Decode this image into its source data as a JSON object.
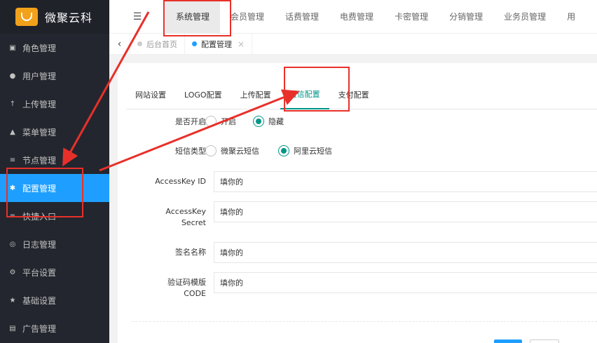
{
  "brand": {
    "name": "微聚云科"
  },
  "sidebar": {
    "items": [
      {
        "label": "角色管理",
        "icon": "role-icon",
        "glyph": "▣"
      },
      {
        "label": "用户管理",
        "icon": "user-icon",
        "glyph": "●"
      },
      {
        "label": "上传管理",
        "icon": "upload-icon",
        "glyph": "↑"
      },
      {
        "label": "菜单管理",
        "icon": "tree-icon",
        "glyph": "▲"
      },
      {
        "label": "节点管理",
        "icon": "list-icon",
        "glyph": "≡"
      },
      {
        "label": "配置管理",
        "icon": "asterisk-icon",
        "glyph": "✱"
      },
      {
        "label": "快捷入口",
        "icon": "list-icon",
        "glyph": "≡"
      },
      {
        "label": "日志管理",
        "icon": "log-icon",
        "glyph": "◎"
      },
      {
        "label": "平台设置",
        "icon": "cogs-icon",
        "glyph": "⚙"
      },
      {
        "label": "基础设置",
        "icon": "star-icon",
        "glyph": "★"
      },
      {
        "label": "广告管理",
        "icon": "image-icon",
        "glyph": "▤"
      }
    ]
  },
  "topnav": {
    "menu_glyph": "☰",
    "tabs": [
      "系统管理",
      "会员管理",
      "话费管理",
      "电费管理",
      "卡密管理",
      "分销管理",
      "业务员管理",
      "用"
    ]
  },
  "pagetabs": {
    "prev": "‹",
    "home": "后台首页",
    "current": "配置管理",
    "close": "×"
  },
  "config": {
    "subtabs": [
      "网站设置",
      "LOGO配置",
      "上传配置",
      "短信配置",
      "支付配置"
    ],
    "enable_label": "是否开启",
    "enable_options": [
      "开启",
      "隐藏"
    ],
    "type_label": "短信类型",
    "type_options": [
      "微聚云短信",
      "阿里云短信"
    ],
    "access_key_id_label": "AccessKey ID",
    "access_key_id_value": "填你的",
    "access_key_secret_label_1": "AccessKey",
    "access_key_secret_label_2": "Secret",
    "access_key_secret_value": "填你的",
    "sign_label": "签名名称",
    "sign_value": "填你的",
    "template_label_1": "验证码模版",
    "template_label_2": "CODE",
    "template_value": "填你的"
  },
  "colors": {
    "sidebar_bg": "#23262e",
    "active_blue": "#1e9fff",
    "accent_teal": "#009688",
    "annotation_red": "#e8302a"
  }
}
